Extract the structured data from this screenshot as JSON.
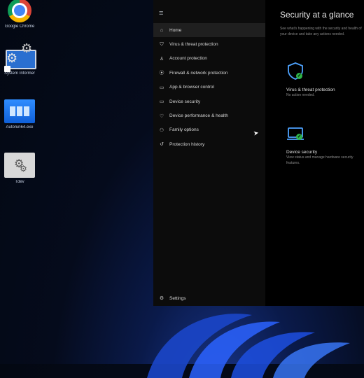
{
  "desktop": {
    "icons": [
      {
        "label": "Google Chrome"
      },
      {
        "label": "System Informer"
      },
      {
        "label": "Autorun64.exe"
      },
      {
        "label": "Tdev"
      }
    ]
  },
  "security_window": {
    "nav_items": [
      {
        "label": "Home"
      },
      {
        "label": "Virus & threat protection"
      },
      {
        "label": "Account protection"
      },
      {
        "label": "Firewall & network protection"
      },
      {
        "label": "App & browser control"
      },
      {
        "label": "Device security"
      },
      {
        "label": "Device performance & health"
      },
      {
        "label": "Family options"
      },
      {
        "label": "Protection history"
      }
    ],
    "settings_label": "Settings",
    "title": "Security at a glance",
    "subtitle": "See what's happening with the security and health of your device and take any actions needed.",
    "cards": [
      {
        "label": "Virus & threat protection",
        "status": "No action needed."
      },
      {
        "label": "Device security",
        "status": "View status and manage hardware security features."
      }
    ]
  },
  "colors": {
    "ok_green": "#2fb34a",
    "shield_blue": "#4ea3ff"
  }
}
